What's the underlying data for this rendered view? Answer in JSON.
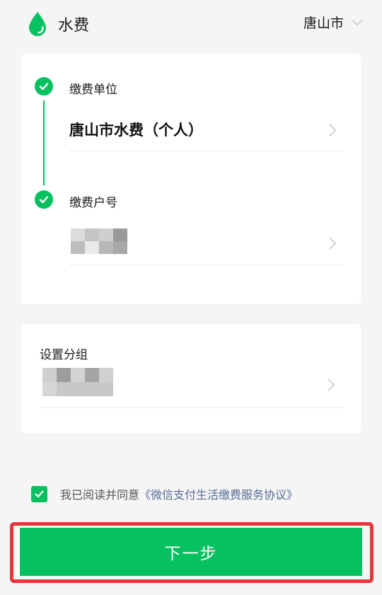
{
  "header": {
    "title": "水费",
    "city": "唐山市"
  },
  "steps": [
    {
      "label": "缴费单位",
      "value": "唐山市水费（个人）"
    },
    {
      "label": "缴费户号"
    }
  ],
  "group": {
    "label": "设置分组"
  },
  "agreement": {
    "prefix": "我已阅读并同意",
    "link": "《微信支付生活缴费服务协议》",
    "checked": true
  },
  "next_button": "下一步",
  "colors": {
    "accent": "#07c160",
    "link": "#576b95",
    "highlight": "#e5363b"
  },
  "icons": [
    "water-drop-icon",
    "chevron-down-icon",
    "check-icon",
    "chevron-right-icon",
    "checkbox-check-icon"
  ]
}
